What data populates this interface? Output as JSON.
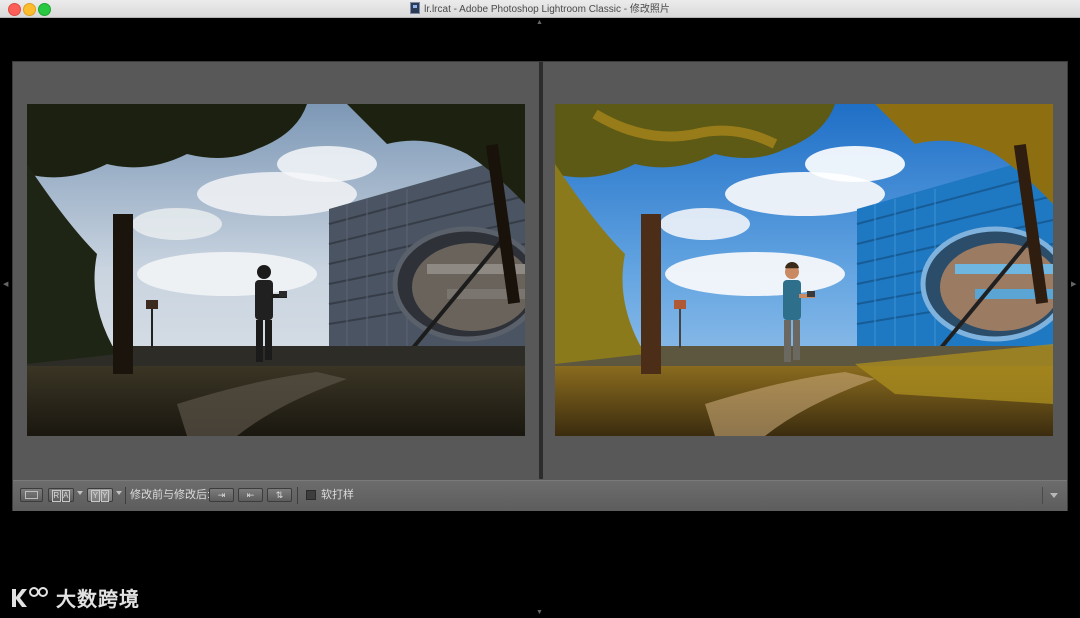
{
  "window": {
    "title": "lr.lrcat - Adobe Photoshop Lightroom Classic - 修改照片",
    "controls": [
      "close",
      "minimize",
      "zoom"
    ]
  },
  "panels": {
    "top_toggle_icon": "triangle-up-icon",
    "bottom_toggle_icon": "triangle-down-icon",
    "left_toggle_icon": "triangle-left-icon",
    "right_toggle_icon": "triangle-right-icon"
  },
  "compare": {
    "before": {
      "icon": "photo-before",
      "description_icon": "boy-with-drone-controller-under-tree"
    },
    "after": {
      "icon": "photo-after",
      "description_icon": "boy-with-drone-controller-under-tree"
    }
  },
  "toolbar": {
    "loupe_icon": "loupe-view-icon",
    "ra_glyphs": [
      "R",
      "A"
    ],
    "yy_glyphs": [
      "Y",
      "Y"
    ],
    "before_after_label": "修改前与修改后:",
    "swap_buttons": [
      "⇥",
      "⇤",
      "⇅"
    ],
    "soft_proof_label": "软打样",
    "soft_proof_checked": false,
    "menu_icon": "chevron-down-icon"
  },
  "watermark": {
    "text": "大数跨境",
    "logo_icon": "k100-logo"
  }
}
